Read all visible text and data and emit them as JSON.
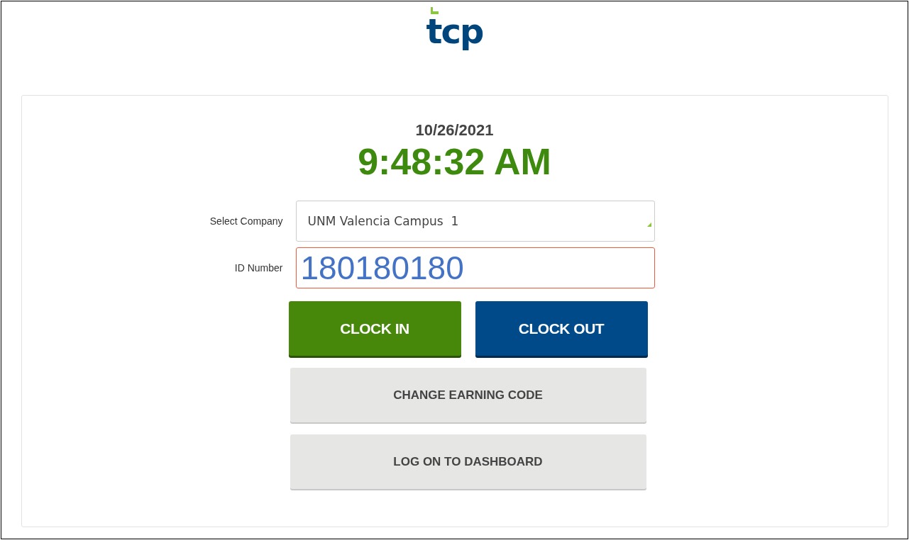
{
  "logo": {
    "text": "tcp"
  },
  "date": "10/26/2021",
  "time": "9:48:32 AM",
  "fields": [
    {
      "label": "Select Company",
      "kind": "select",
      "value": "UNM Valencia Campus  1",
      "invalid": false
    },
    {
      "label": "ID Number",
      "kind": "text",
      "value": "180180180",
      "invalid": true
    }
  ],
  "clock_buttons": [
    {
      "label": "CLOCK IN",
      "kind": "in"
    },
    {
      "label": "CLOCK OUT",
      "kind": "out"
    }
  ],
  "buttons": [
    "CHANGE EARNING CODE",
    "LOG ON TO DASHBOARD"
  ]
}
